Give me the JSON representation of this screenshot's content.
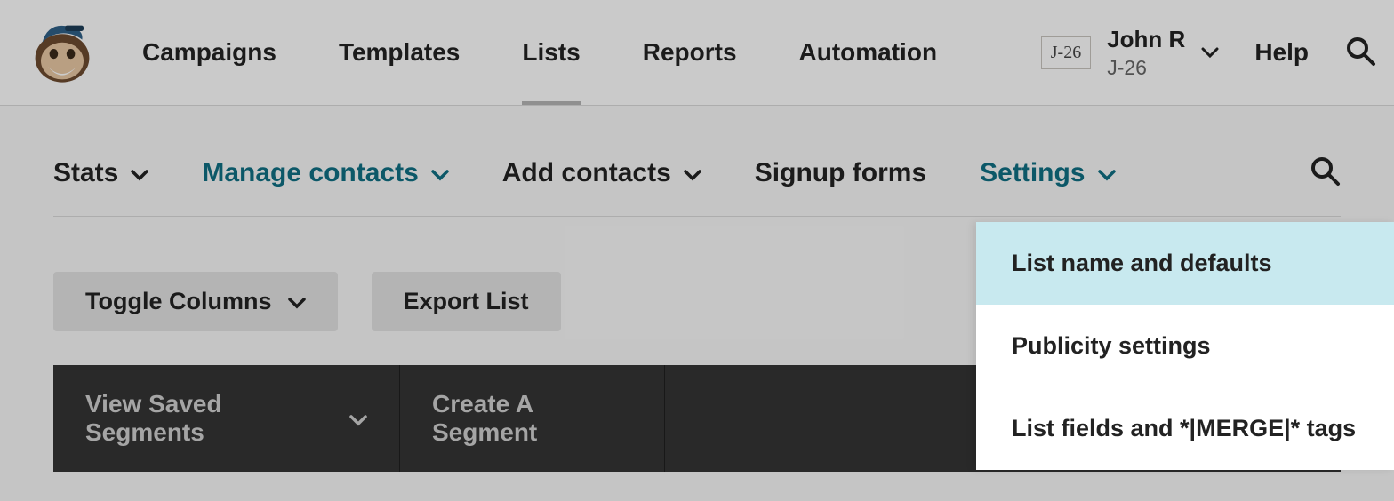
{
  "header": {
    "nav": {
      "campaigns": "Campaigns",
      "templates": "Templates",
      "lists": "Lists",
      "reports": "Reports",
      "automation": "Automation"
    },
    "account": {
      "badge": "J-26",
      "name": "John R",
      "org": "J-26"
    },
    "help": "Help"
  },
  "subnav": {
    "stats": "Stats",
    "manage_contacts": "Manage contacts",
    "add_contacts": "Add contacts",
    "signup_forms": "Signup forms",
    "settings": "Settings"
  },
  "buttons": {
    "toggle_columns": "Toggle Columns",
    "export_list": "Export List"
  },
  "segments": {
    "view_saved": "View Saved Segments",
    "create": "Create A Segment"
  },
  "settings_dropdown": {
    "items": [
      "List name and defaults",
      "Publicity settings",
      "List fields and *|MERGE|* tags"
    ]
  }
}
